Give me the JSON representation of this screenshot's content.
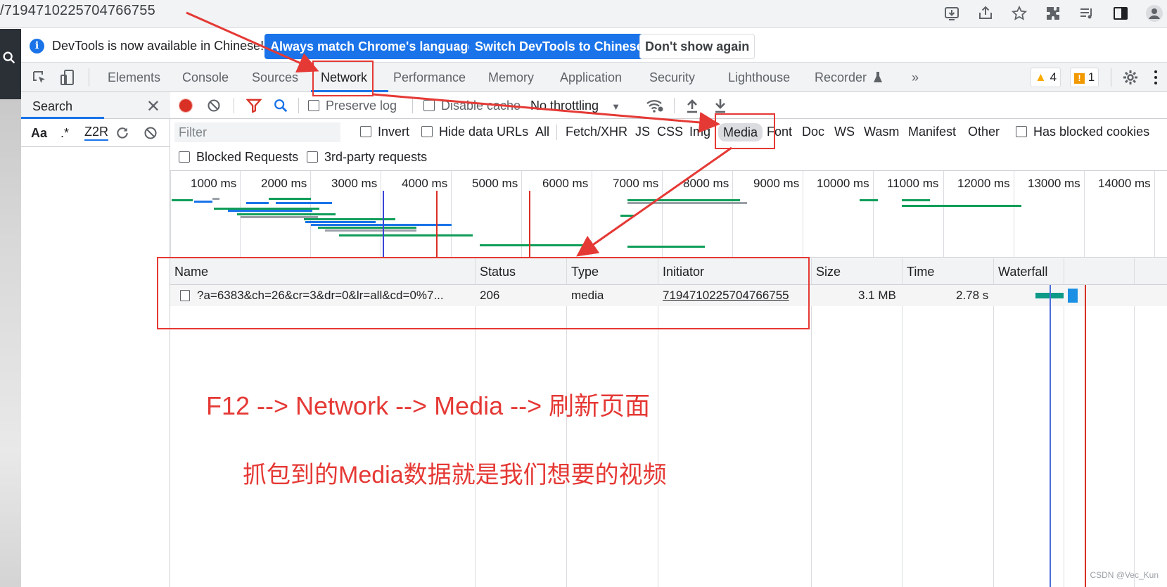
{
  "browser": {
    "url": "/7194710225704766755"
  },
  "infobar": {
    "message": "DevTools is now available in Chinese!",
    "btn_match": "Always match Chrome's language",
    "btn_switch": "Switch DevTools to Chinese",
    "btn_dismiss": "Don't show again"
  },
  "tabs": [
    "Elements",
    "Console",
    "Sources",
    "Network",
    "Performance",
    "Memory",
    "Application",
    "Security",
    "Lighthouse",
    "Recorder",
    "»"
  ],
  "badges": {
    "warnings": "4",
    "issues": "1"
  },
  "search_panel": {
    "title": "Search",
    "opt_case": "Aa",
    "opt_regex": ".*",
    "query": "Z2R"
  },
  "toolbar": {
    "preserve_log": "Preserve log",
    "disable_cache": "Disable cache",
    "throttling": "No throttling"
  },
  "filter": {
    "placeholder": "Filter",
    "invert": "Invert",
    "hide_data_urls": "Hide data URLs",
    "types": [
      "All",
      "Fetch/XHR",
      "JS",
      "CSS",
      "Img",
      "Media",
      "Font",
      "Doc",
      "WS",
      "Wasm",
      "Manifest",
      "Other"
    ],
    "selected_type": "Media",
    "has_blocked_cookies": "Has blocked cookies",
    "blocked_requests": "Blocked Requests",
    "third_party": "3rd-party requests"
  },
  "overview": {
    "ticks": [
      "1000 ms",
      "2000 ms",
      "3000 ms",
      "4000 ms",
      "5000 ms",
      "6000 ms",
      "7000 ms",
      "8000 ms",
      "9000 ms",
      "10000 ms",
      "11000 ms",
      "12000 ms",
      "13000 ms",
      "14000 ms"
    ]
  },
  "table": {
    "columns": [
      "Name",
      "Status",
      "Type",
      "Initiator",
      "Size",
      "Time",
      "Waterfall"
    ],
    "rows": [
      {
        "name": "?a=6383&ch=26&cr=3&dr=0&lr=all&cd=0%7...",
        "status": "206",
        "type": "media",
        "initiator": "7194710225704766755",
        "size": "3.1 MB",
        "time": "2.78 s"
      }
    ]
  },
  "annotations": {
    "line1": "F12 --> Network --> Media --> 刷新页面",
    "line2": "抓包到的Media数据就是我们想要的视频"
  },
  "watermark": "CSDN @Vec_Kun",
  "colors": {
    "accent": "#1a73e8",
    "annotation": "#e53935",
    "record": "#d93025"
  }
}
